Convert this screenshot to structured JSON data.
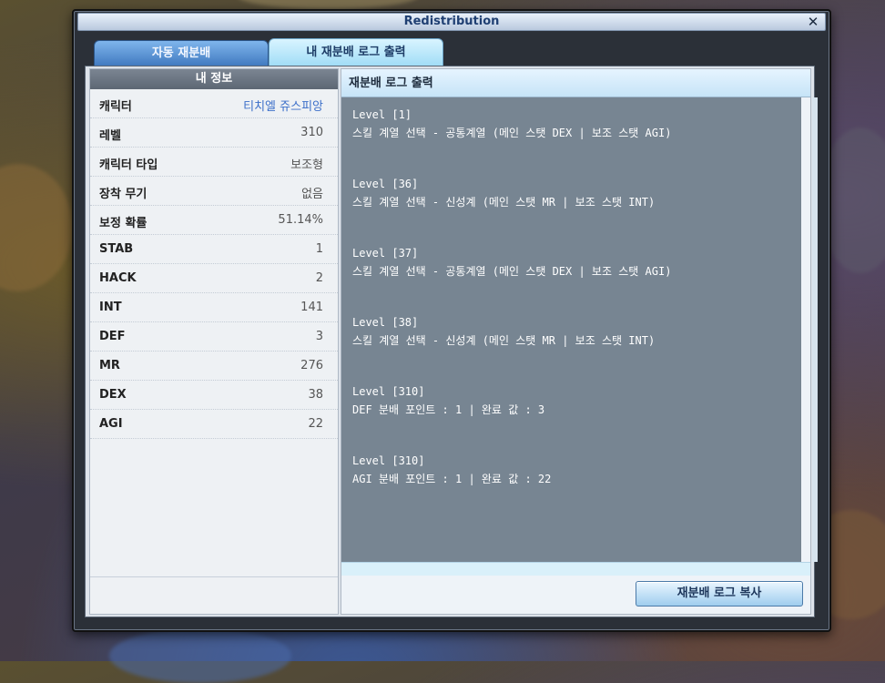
{
  "window": {
    "title": "Redistribution",
    "close_glyph": "✕"
  },
  "tabs": [
    {
      "label": "자동 재분배"
    },
    {
      "label": "내 재분배 로그 출력"
    }
  ],
  "left": {
    "header": "내 정보",
    "rows": [
      {
        "key": "캐릭터",
        "value": "티치엘 쥬스피앙"
      },
      {
        "key": "레벨",
        "value": "310"
      },
      {
        "key": "캐릭터 타입",
        "value": "보조형"
      },
      {
        "key": "장착 무기",
        "value": "없음"
      },
      {
        "key": "보정 확률",
        "value": "51.14%"
      },
      {
        "key": "STAB",
        "value": "1"
      },
      {
        "key": "HACK",
        "value": "2"
      },
      {
        "key": "INT",
        "value": "141"
      },
      {
        "key": "DEF",
        "value": "3"
      },
      {
        "key": "MR",
        "value": "276"
      },
      {
        "key": "DEX",
        "value": "38"
      },
      {
        "key": "AGI",
        "value": "22"
      }
    ]
  },
  "right": {
    "header": "재분배 로그 출력",
    "log": [
      {
        "level": "Level [1]",
        "text": "스킬 계열 선택 - 공통계열 (메인 스탯 DEX | 보조 스탯 AGI)"
      },
      {
        "level": "Level [36]",
        "text": "스킬 계열 선택 - 신성계 (메인 스탯 MR | 보조 스탯 INT)"
      },
      {
        "level": "Level [37]",
        "text": "스킬 계열 선택 - 공통계열 (메인 스탯 DEX | 보조 스탯 AGI)"
      },
      {
        "level": "Level [38]",
        "text": "스킬 계열 선택 - 신성계 (메인 스탯 MR | 보조 스탯 INT)"
      },
      {
        "level": "Level [310]",
        "text": "DEF 분배 포인트 : 1 | 완료 값 : 3"
      },
      {
        "level": "Level [310]",
        "text": "AGI 분배 포인트 : 1 | 완료 값 : 22"
      }
    ],
    "copy_button": "재분배 로그 복사"
  },
  "colors": {
    "accent_blue": "#3c6fc9",
    "log_bg": "#778592",
    "title_text": "#1f3f72"
  }
}
